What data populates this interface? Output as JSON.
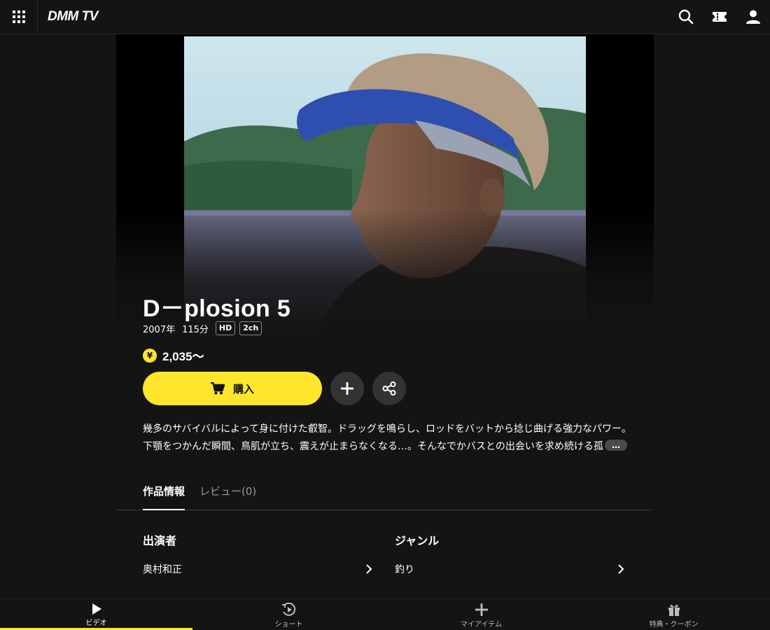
{
  "header": {
    "logo": "DMM TV",
    "icons": [
      "apps-grid-icon",
      "search-icon",
      "ticket-icon",
      "account-icon"
    ]
  },
  "title": {
    "name": "D－plosion 5",
    "year": "2007年",
    "duration": "115分",
    "tags": [
      "HD",
      "2ch"
    ]
  },
  "price": {
    "currency_symbol": "¥",
    "amount": "2,035～"
  },
  "actions": {
    "buy_label": "購入",
    "add_icon": "plus-icon",
    "share_icon": "share-icon"
  },
  "description": {
    "line1": "幾多のサバイバルによって身に付けた叡智。ドラッグを鳴らし、ロッドをバットから捻じ曲げる強力なパワー。",
    "line2": "下顎をつかんだ瞬間、鳥肌が立ち、震えが止まらなくなる…。そんなでかバスとの出会いを求め続ける孤",
    "more": "…"
  },
  "tabs": {
    "info": "作品情報",
    "review": "レビュー(0)"
  },
  "info": {
    "cast_heading": "出演者",
    "cast_value": "奥村和正",
    "genre_heading": "ジャンル",
    "genre_value": "釣り"
  },
  "bottom_nav": {
    "items": [
      {
        "label": "ビデオ",
        "icon": "play-icon",
        "active": true
      },
      {
        "label": "ショート",
        "icon": "shorts-icon",
        "active": false
      },
      {
        "label": "マイアイテム",
        "icon": "plus-icon",
        "active": false
      },
      {
        "label": "特典・クーポン",
        "icon": "gift-icon",
        "active": false
      }
    ]
  },
  "colors": {
    "accent": "#ffe52b",
    "background": "#141414"
  }
}
